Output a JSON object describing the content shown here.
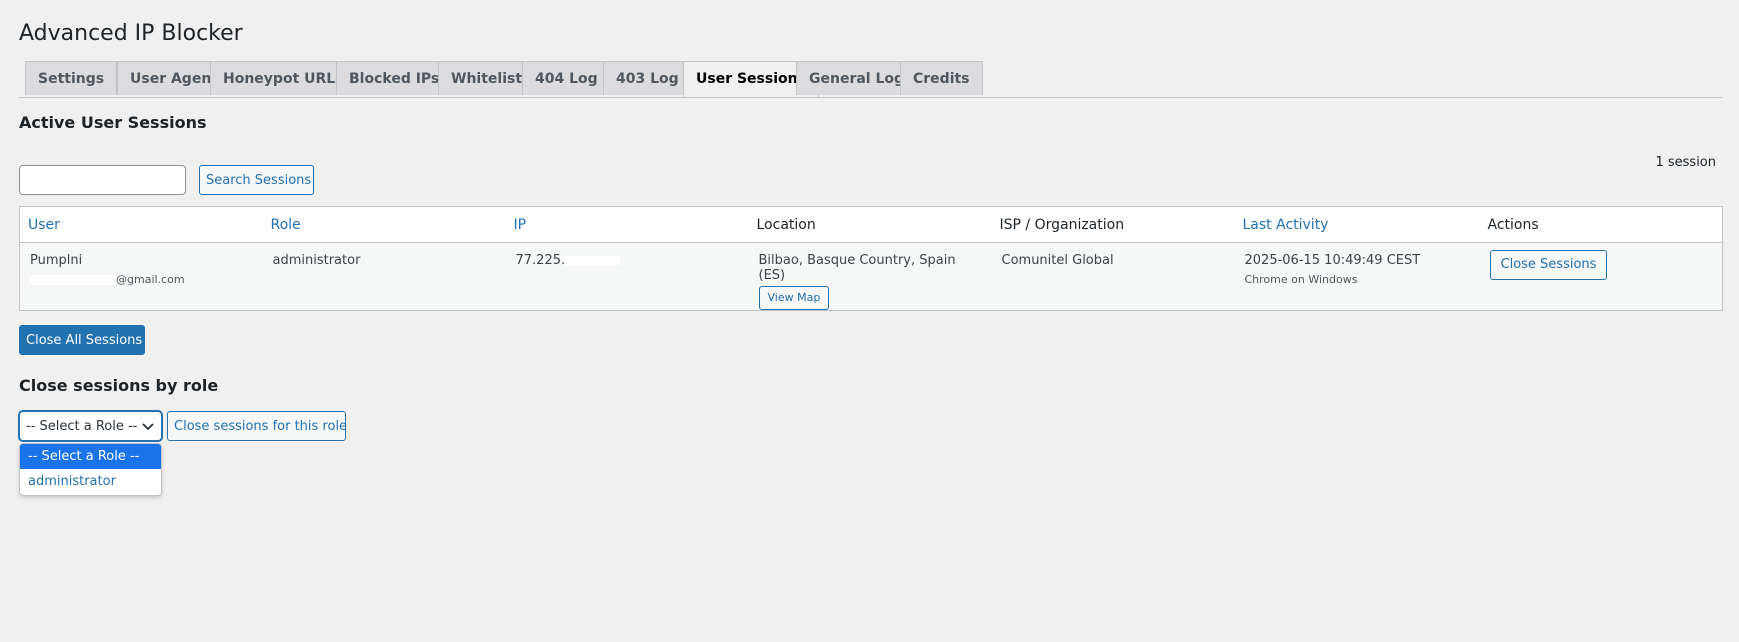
{
  "app": {
    "title": "Advanced IP Blocker"
  },
  "tabs": [
    {
      "label": "Settings"
    },
    {
      "label": "User Agents"
    },
    {
      "label": "Honeypot URLs"
    },
    {
      "label": "Blocked IPs"
    },
    {
      "label": "Whitelist"
    },
    {
      "label": "404 Log"
    },
    {
      "label": "403 Log"
    },
    {
      "label": "User Sessions",
      "active": true
    },
    {
      "label": "General Log"
    },
    {
      "label": "Credits"
    }
  ],
  "active_sessions": {
    "heading": "Active User Sessions",
    "search_value": "",
    "search_button": "Search Sessions",
    "count_text": "1 session",
    "columns": {
      "user": "User",
      "role": "Role",
      "ip": "IP",
      "location": "Location",
      "isp": "ISP / Organization",
      "last_activity": "Last Activity",
      "actions": "Actions"
    },
    "rows": [
      {
        "user_name": "Pumplni",
        "user_email": "@gmail.com",
        "role": "administrator",
        "ip": "77.225.",
        "location": "Bilbao, Basque Country, Spain (ES)",
        "view_map": "View Map",
        "isp": "Comunitel Global",
        "last_activity": "2025-06-15 10:49:49 CEST",
        "browser": "Chrome on Windows",
        "close_button": "Close Sessions"
      }
    ],
    "close_all_button": "Close All Sessions"
  },
  "by_role": {
    "heading": "Close sessions by role",
    "select_value": "-- Select a Role --",
    "options": [
      "-- Select a Role --",
      "administrator"
    ],
    "close_button": "Close sessions for this role"
  },
  "colors": {
    "accent": "#2271b1",
    "background": "#f0f0f1",
    "dropdown_highlight": "#1a73e8"
  }
}
